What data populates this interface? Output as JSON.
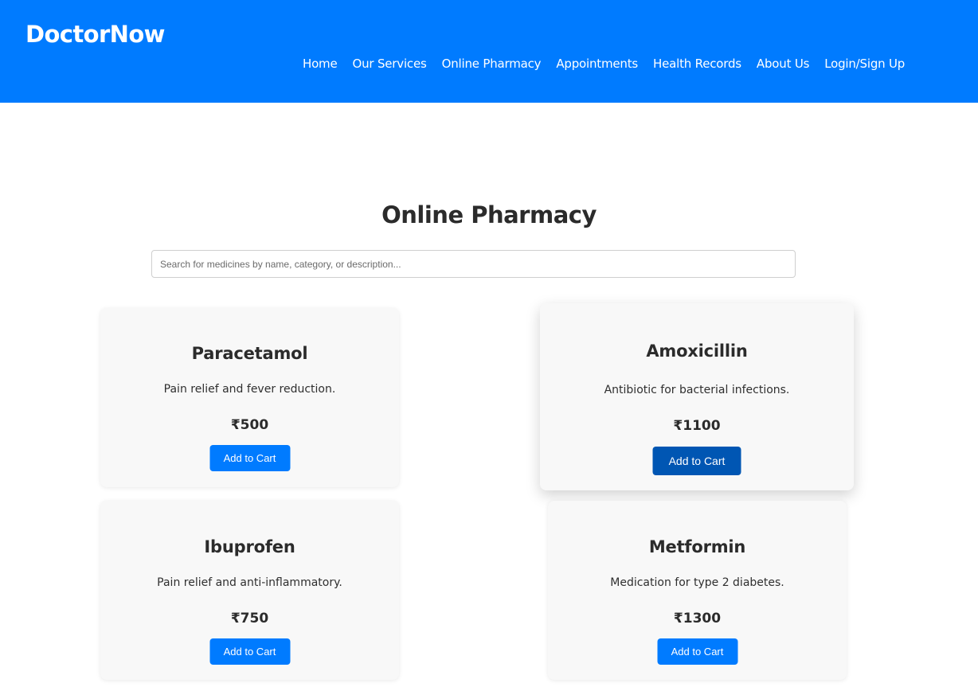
{
  "brand": "DoctorNow",
  "nav": [
    "Home",
    "Our Services",
    "Online Pharmacy",
    "Appointments",
    "Health Records",
    "About Us",
    "Login/Sign Up"
  ],
  "page": {
    "title": "Online Pharmacy",
    "search_placeholder": "Search for medicines by name, category, or description..."
  },
  "products": [
    {
      "name": "Paracetamol",
      "description": "Pain relief and fever reduction.",
      "price": "₹500",
      "button": "Add to Cart"
    },
    {
      "name": "Amoxicillin",
      "description": "Antibiotic for bacterial infections.",
      "price": "₹1100",
      "button": "Add to Cart"
    },
    {
      "name": "Ibuprofen",
      "description": "Pain relief and anti-inflammatory.",
      "price": "₹750",
      "button": "Add to Cart"
    },
    {
      "name": "Metformin",
      "description": "Medication for type 2 diabetes.",
      "price": "₹1300",
      "button": "Add to Cart"
    }
  ],
  "colors": {
    "primary": "#007bff",
    "primary_hover": "#0056b3",
    "card_bg": "#f8f8f8",
    "text": "#2b2b2b"
  }
}
